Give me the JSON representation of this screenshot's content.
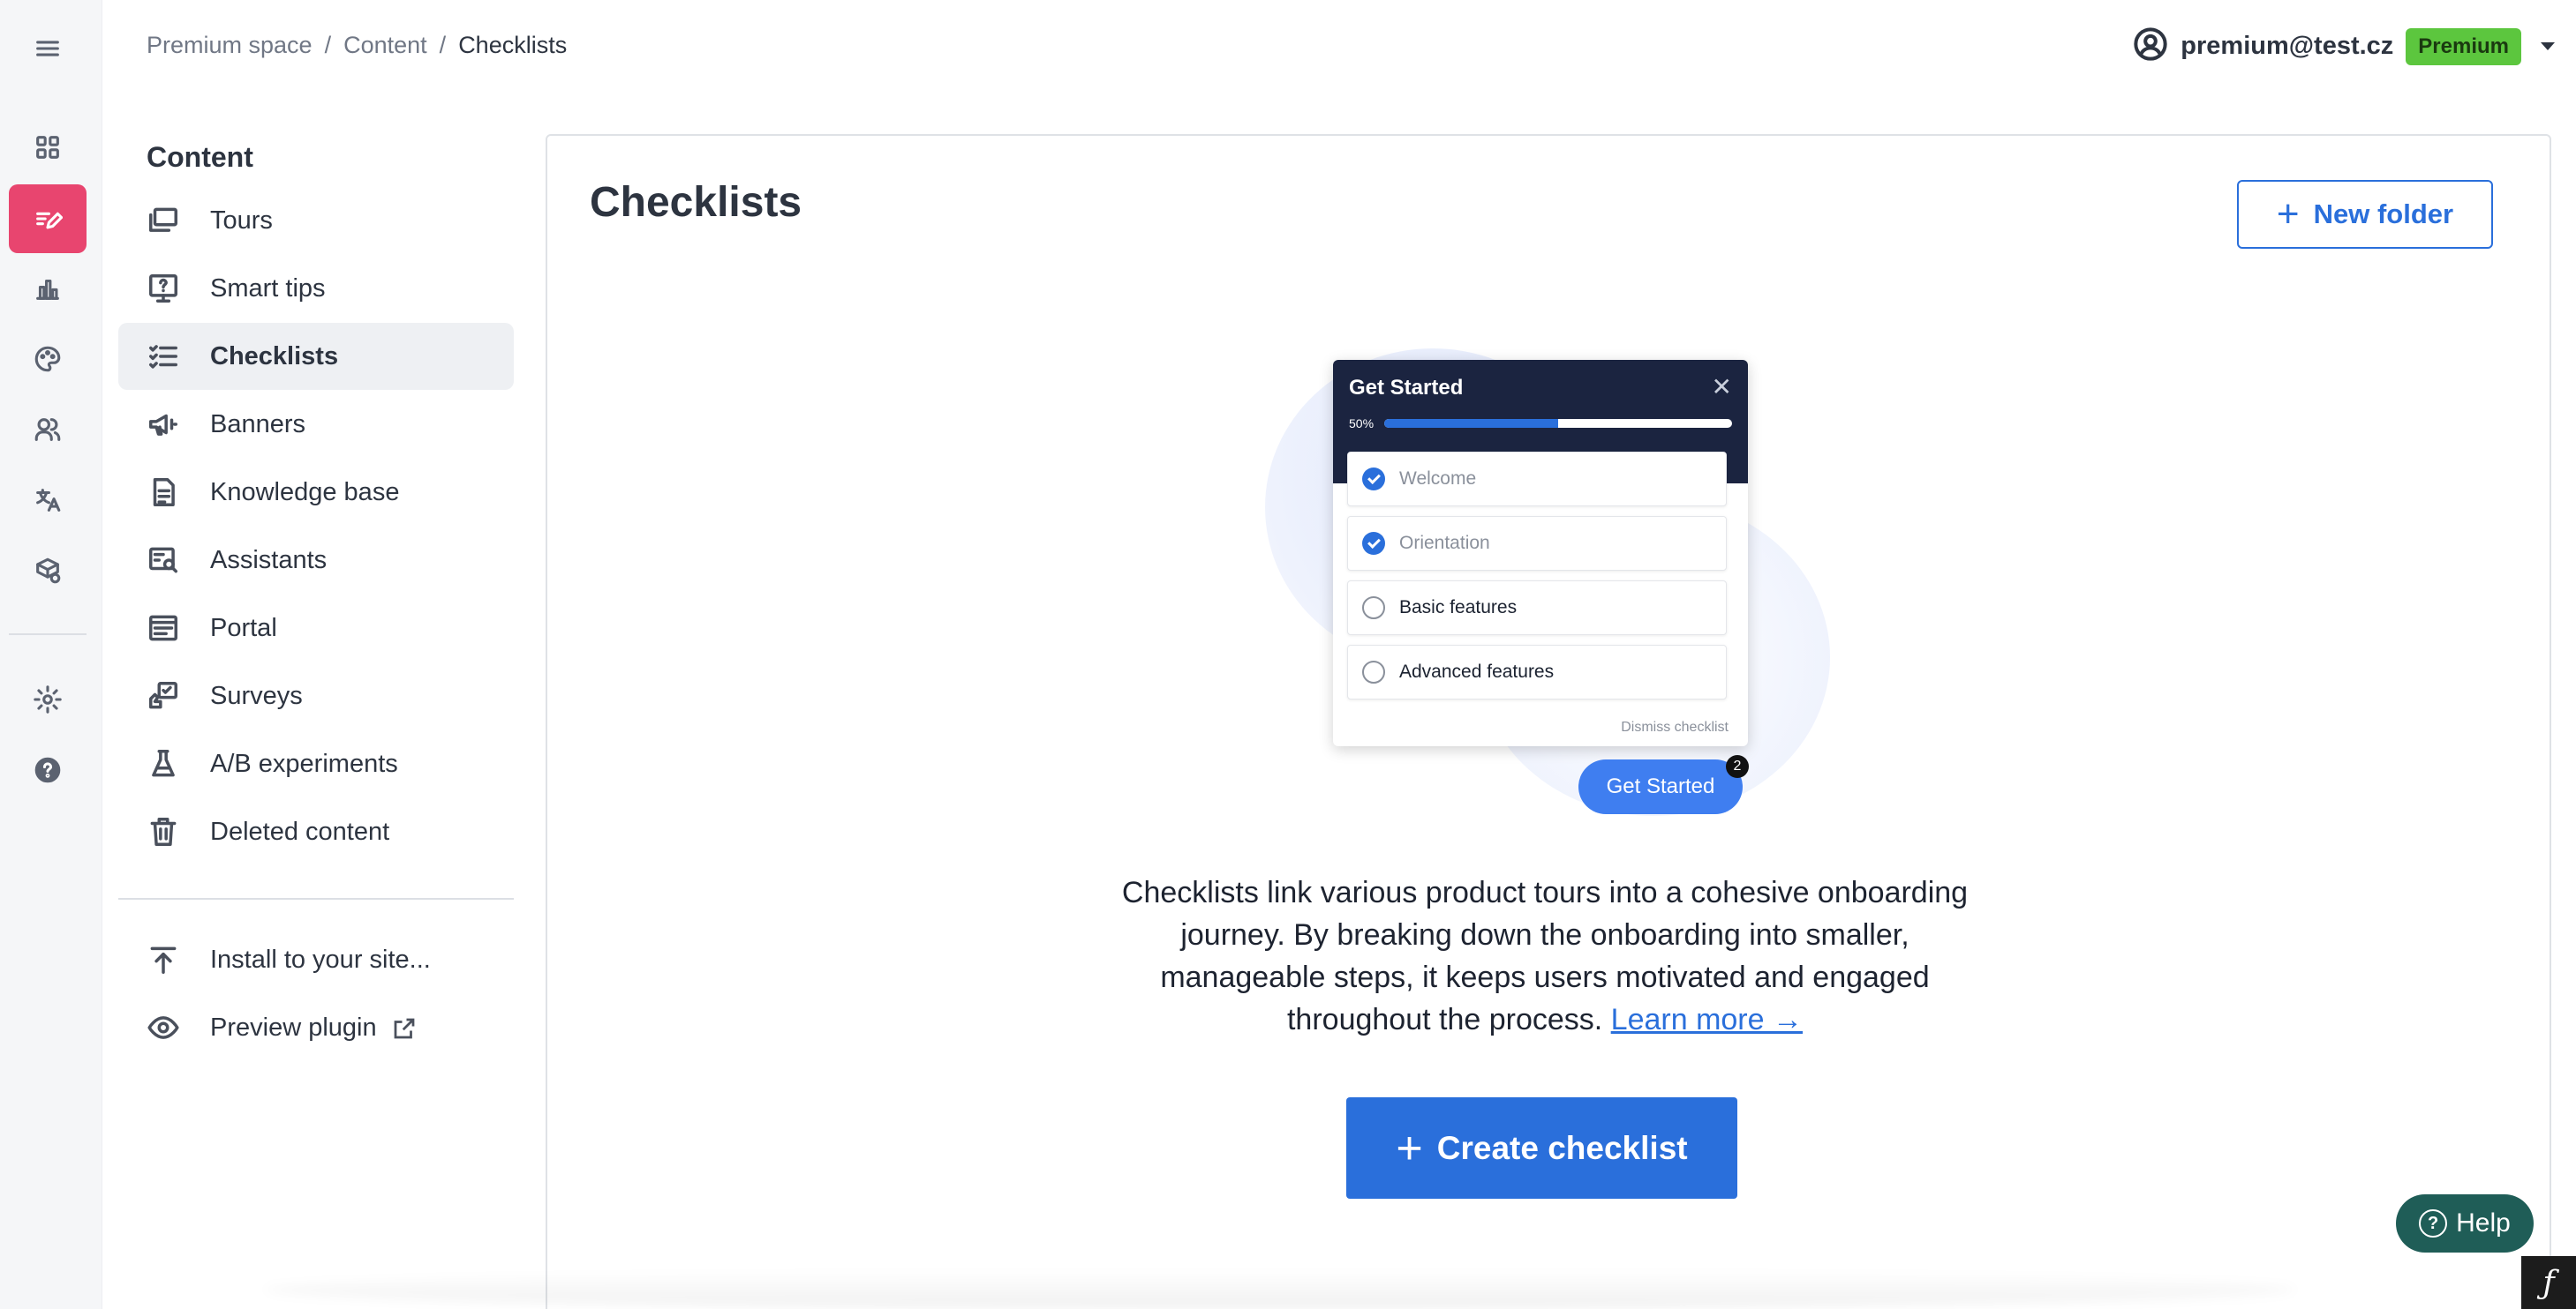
{
  "rail": {
    "items": [
      {
        "name": "menu-icon"
      },
      {
        "name": "dashboard-icon"
      },
      {
        "name": "content-edit-icon",
        "active": true
      },
      {
        "name": "analytics-icon"
      },
      {
        "name": "palette-icon"
      },
      {
        "name": "users-icon"
      },
      {
        "name": "translate-icon"
      },
      {
        "name": "integrations-icon"
      },
      {
        "name": "settings-icon"
      },
      {
        "name": "help-circle-icon"
      }
    ],
    "active_color": "#e8456f"
  },
  "breadcrumb": {
    "items": [
      "Premium space",
      "Content",
      "Checklists"
    ],
    "separator": "/"
  },
  "user": {
    "email": "premium@test.cz",
    "plan": "Premium",
    "plan_color": "#5cc63e"
  },
  "nav": {
    "title": "Content",
    "items": [
      {
        "label": "Tours",
        "icon": "tours-icon"
      },
      {
        "label": "Smart tips",
        "icon": "smart-tips-icon"
      },
      {
        "label": "Checklists",
        "icon": "checklist-icon",
        "active": true
      },
      {
        "label": "Banners",
        "icon": "megaphone-icon"
      },
      {
        "label": "Knowledge base",
        "icon": "document-icon"
      },
      {
        "label": "Assistants",
        "icon": "assistant-icon"
      },
      {
        "label": "Portal",
        "icon": "portal-icon"
      },
      {
        "label": "Surveys",
        "icon": "survey-icon"
      },
      {
        "label": "A/B experiments",
        "icon": "flask-icon"
      },
      {
        "label": "Deleted content",
        "icon": "trash-icon"
      }
    ],
    "footer_items": [
      {
        "label": "Install to your site...",
        "icon": "upload-icon"
      },
      {
        "label": "Preview plugin",
        "icon": "eye-icon"
      }
    ]
  },
  "main": {
    "title": "Checklists",
    "new_folder_label": "New folder",
    "accent_color": "#2a6fdb",
    "illustration": {
      "title": "Get Started",
      "progress_label": "50%",
      "progress": 0.5,
      "items": [
        {
          "label": "Welcome",
          "done": true
        },
        {
          "label": "Orientation",
          "done": true
        },
        {
          "label": "Basic features",
          "done": false
        },
        {
          "label": "Advanced features",
          "done": false
        }
      ],
      "dismiss_label": "Dismiss checklist",
      "button_label": "Get Started",
      "button_count": "2"
    },
    "description": "Checklists link various product tours into a cohesive onboarding journey. By breaking down the onboarding into smaller, manageable steps, it keeps users motivated and engaged throughout the process.",
    "learn_more_label": "Learn more →",
    "create_label": "Create checklist"
  },
  "help_label": "Help"
}
